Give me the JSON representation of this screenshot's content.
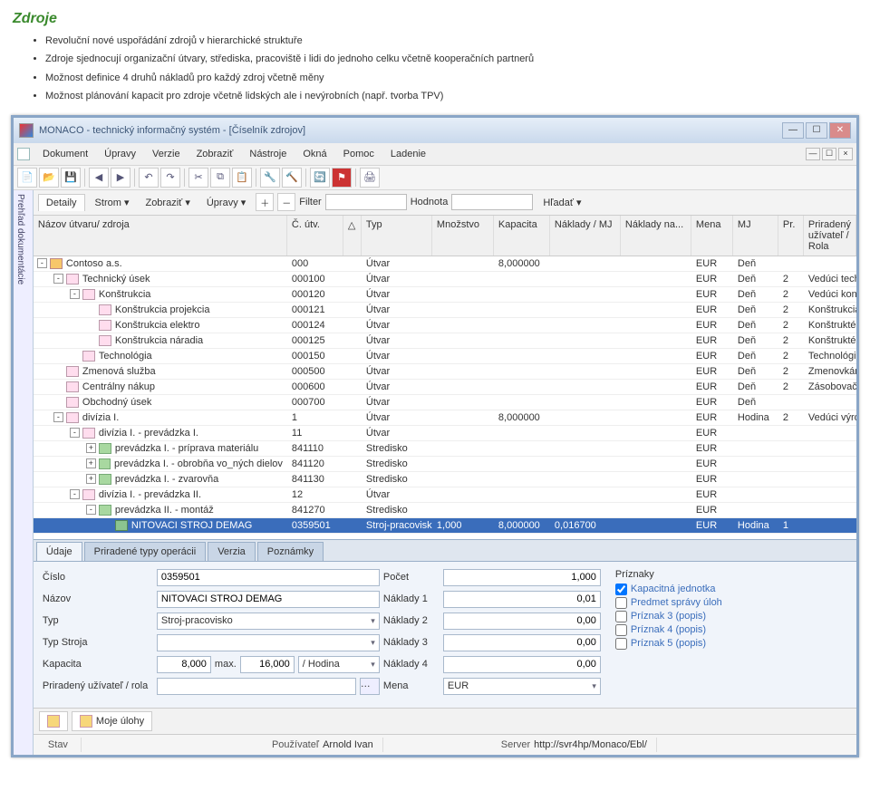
{
  "doc": {
    "title": "Zdroje",
    "bullets": [
      "Revoluční nové uspořádání zdrojů v hierarchické struktuře",
      "Zdroje sjednocují organizační útvary, střediska, pracoviště i lidi do jednoho celku včetně kooperačních partnerů",
      "Možnost definice 4 druhů nákladů pro každý zdroj včetně měny",
      "Možnost plánování kapacit pro zdroje včetně lidských ale i nevýrobních (např. tvorba TPV)"
    ]
  },
  "window": {
    "title": "MONACO - technický informačný systém - [Číselník zdrojov]"
  },
  "menu": [
    "Dokument",
    "Úpravy",
    "Verzie",
    "Zobraziť",
    "Nástroje",
    "Okná",
    "Pomoc",
    "Ladenie"
  ],
  "sidetab": "Prehľad dokumentácie",
  "treebar": {
    "tab": "Detaily",
    "buttons": [
      "Strom ▾",
      "Zobraziť ▾",
      "Úpravy ▾"
    ],
    "filter_label": "Filter",
    "hodnota_label": "Hodnota",
    "hladat_label": "Hľadať ▾"
  },
  "columns": [
    "Názov útvaru/ zdroja",
    "Č. útv.",
    "△",
    "Typ",
    "Množstvo",
    "Kapacita",
    "Náklady / MJ",
    "Náklady na...",
    "Mena",
    "MJ",
    "Pr.",
    "Priradený užívateľ / Rola"
  ],
  "rows": [
    {
      "ind": 0,
      "exp": "-",
      "ic": "org",
      "name": "Contoso a.s.",
      "c": "000",
      "typ": "Útvar",
      "mn": "",
      "kap": "8,000000",
      "n1": "",
      "n2": "",
      "mena": "EUR",
      "mj": "Deň",
      "pr": "",
      "user": ""
    },
    {
      "ind": 1,
      "exp": "-",
      "ic": "dept",
      "name": "Technický úsek",
      "c": "000100",
      "typ": "Útvar",
      "mn": "",
      "kap": "",
      "n1": "",
      "n2": "",
      "mena": "EUR",
      "mj": "Deň",
      "pr": "2",
      "user": "Vedúci tech.úseku"
    },
    {
      "ind": 2,
      "exp": "-",
      "ic": "dept",
      "name": "Konštrukcia",
      "c": "000120",
      "typ": "Útvar",
      "mn": "",
      "kap": "",
      "n1": "",
      "n2": "",
      "mena": "EUR",
      "mj": "Deň",
      "pr": "2",
      "user": "Vedúci konštruktér"
    },
    {
      "ind": 3,
      "exp": "",
      "ic": "dept",
      "name": "Konštrukcia projekcia",
      "c": "000121",
      "typ": "Útvar",
      "mn": "",
      "kap": "",
      "n1": "",
      "n2": "",
      "mena": "EUR",
      "mj": "Deň",
      "pr": "2",
      "user": "Konštrukcia Proj"
    },
    {
      "ind": 3,
      "exp": "",
      "ic": "dept",
      "name": "Konštrukcia elektro",
      "c": "000124",
      "typ": "Útvar",
      "mn": "",
      "kap": "",
      "n1": "",
      "n2": "",
      "mena": "EUR",
      "mj": "Deň",
      "pr": "2",
      "user": "Konštruktéri Elektro"
    },
    {
      "ind": 3,
      "exp": "",
      "ic": "dept",
      "name": "Konštrukcia náradia",
      "c": "000125",
      "typ": "Útvar",
      "mn": "",
      "kap": "",
      "n1": "",
      "n2": "",
      "mena": "EUR",
      "mj": "Deň",
      "pr": "2",
      "user": "Konštruktéri náradia"
    },
    {
      "ind": 2,
      "exp": "",
      "ic": "dept",
      "name": "Technológia",
      "c": "000150",
      "typ": "Útvar",
      "mn": "",
      "kap": "",
      "n1": "",
      "n2": "",
      "mena": "EUR",
      "mj": "Deň",
      "pr": "2",
      "user": "Technológia postupy"
    },
    {
      "ind": 1,
      "exp": "",
      "ic": "dept",
      "name": "Zmenová služba",
      "c": "000500",
      "typ": "Útvar",
      "mn": "",
      "kap": "",
      "n1": "",
      "n2": "",
      "mena": "EUR",
      "mj": "Deň",
      "pr": "2",
      "user": "Zmenovkári"
    },
    {
      "ind": 1,
      "exp": "",
      "ic": "dept",
      "name": "Centrálny nákup",
      "c": "000600",
      "typ": "Útvar",
      "mn": "",
      "kap": "",
      "n1": "",
      "n2": "",
      "mena": "EUR",
      "mj": "Deň",
      "pr": "2",
      "user": "Zásobovači"
    },
    {
      "ind": 1,
      "exp": "",
      "ic": "dept",
      "name": "Obchodný úsek",
      "c": "000700",
      "typ": "Útvar",
      "mn": "",
      "kap": "",
      "n1": "",
      "n2": "",
      "mena": "EUR",
      "mj": "Deň",
      "pr": "",
      "user": ""
    },
    {
      "ind": 1,
      "exp": "-",
      "ic": "dept",
      "name": "divízia I.",
      "c": "1",
      "typ": "Útvar",
      "mn": "",
      "kap": "8,000000",
      "n1": "",
      "n2": "",
      "mena": "EUR",
      "mj": "Hodina",
      "pr": "2",
      "user": "Vedúci výroby"
    },
    {
      "ind": 2,
      "exp": "-",
      "ic": "dept",
      "name": "divízia I. - prevádzka I.",
      "c": "11",
      "typ": "Útvar",
      "mn": "",
      "kap": "",
      "n1": "",
      "n2": "",
      "mena": "EUR",
      "mj": "",
      "pr": "",
      "user": ""
    },
    {
      "ind": 3,
      "exp": "+",
      "ic": "wrk",
      "name": "prevádzka I.   - príprava materiálu",
      "c": "841110",
      "typ": "Stredisko",
      "mn": "",
      "kap": "",
      "n1": "",
      "n2": "",
      "mena": "EUR",
      "mj": "",
      "pr": "",
      "user": ""
    },
    {
      "ind": 3,
      "exp": "+",
      "ic": "wrk",
      "name": "prevádzka I.   - obrobňa vo_ných dielov",
      "c": "841120",
      "typ": "Stredisko",
      "mn": "",
      "kap": "",
      "n1": "",
      "n2": "",
      "mena": "EUR",
      "mj": "",
      "pr": "",
      "user": ""
    },
    {
      "ind": 3,
      "exp": "+",
      "ic": "wrk",
      "name": "prevádzka I.   - zvarovňa",
      "c": "841130",
      "typ": "Stredisko",
      "mn": "",
      "kap": "",
      "n1": "",
      "n2": "",
      "mena": "EUR",
      "mj": "",
      "pr": "",
      "user": ""
    },
    {
      "ind": 2,
      "exp": "-",
      "ic": "dept",
      "name": "divízia I. - prevádzka II.",
      "c": "12",
      "typ": "Útvar",
      "mn": "",
      "kap": "",
      "n1": "",
      "n2": "",
      "mena": "EUR",
      "mj": "",
      "pr": "",
      "user": ""
    },
    {
      "ind": 3,
      "exp": "-",
      "ic": "wrk",
      "name": "prevádzka II.   - montáž",
      "c": "841270",
      "typ": "Stredisko",
      "mn": "",
      "kap": "",
      "n1": "",
      "n2": "",
      "mena": "EUR",
      "mj": "",
      "pr": "",
      "user": ""
    },
    {
      "ind": 4,
      "exp": "",
      "ic": "mch",
      "name": "NITOVACI STROJ DEMAG",
      "c": "0359501",
      "typ": "Stroj-pracovisko",
      "mn": "1,000",
      "kap": "8,000000",
      "n1": "0,016700",
      "n2": "",
      "mena": "EUR",
      "mj": "Hodina",
      "pr": "1",
      "user": "",
      "sel": true
    }
  ],
  "bottom_tabs": [
    "Údaje",
    "Priradené typy operácii",
    "Verzia",
    "Poznámky"
  ],
  "form": {
    "labels": {
      "cislo": "Číslo",
      "nazov": "Názov",
      "typ": "Typ",
      "typStroja": "Typ Stroja",
      "kapacita": "Kapacita",
      "max": "max.",
      "priradeny": "Priradený užívateľ / rola",
      "pocet": "Počet",
      "nak1": "Náklady 1",
      "nak2": "Náklady 2",
      "nak3": "Náklady 3",
      "nak4": "Náklady 4",
      "mena": "Mena"
    },
    "values": {
      "cislo": "0359501",
      "nazov": "NITOVACI STROJ DEMAG",
      "typ": "Stroj-pracovisko",
      "typStroja": "",
      "kapacita": "8,000",
      "kapMax": "16,000",
      "kapUnit": "/ Hodina",
      "priradeny": "",
      "pocet": "1,000",
      "nak1": "0,01",
      "nak2": "0,00",
      "nak3": "0,00",
      "nak4": "0,00",
      "mena": "EUR"
    },
    "priznaky": {
      "head": "Príznaky",
      "items": [
        {
          "l": "Kapacitná jednotka",
          "c": true
        },
        {
          "l": "Predmet správy úloh",
          "c": false
        },
        {
          "l": "Príznak 3 (popis)",
          "c": false
        },
        {
          "l": "Príznak 4 (popis)",
          "c": false
        },
        {
          "l": "Príznak 5 (popis)",
          "c": false
        }
      ]
    }
  },
  "bottombar": {
    "moje": "Moje úlohy"
  },
  "status": {
    "stav_l": "Stav",
    "pouzivatel_l": "Používateľ",
    "pouzivatel": "Arnold Ivan",
    "server_l": "Server",
    "server": "http://svr4hp/Monaco/Ebl/"
  }
}
